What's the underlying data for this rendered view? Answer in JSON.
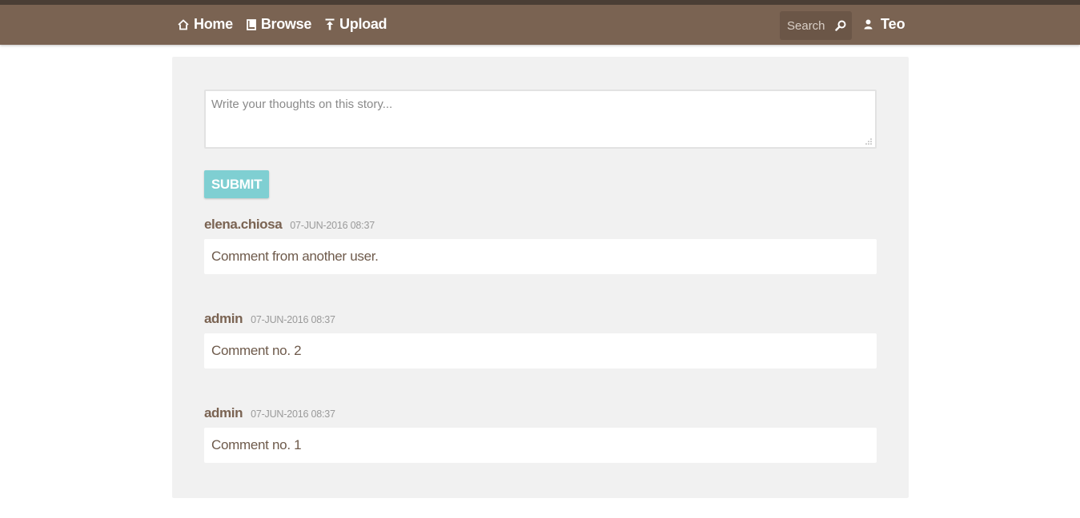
{
  "nav": {
    "items": [
      {
        "label": "Home",
        "icon": "home-icon"
      },
      {
        "label": "Browse",
        "icon": "book-icon"
      },
      {
        "label": "Upload",
        "icon": "upload-icon"
      }
    ],
    "search": {
      "placeholder": "Search",
      "icon": "search-icon"
    },
    "user": {
      "name": "Teo",
      "icon": "user-icon"
    }
  },
  "comment_form": {
    "placeholder": "Write your thoughts on this story...",
    "submit_label": "SUBMIT"
  },
  "comments": [
    {
      "author": "elena.chiosa",
      "date": "07-JUN-2016 08:37",
      "text": "Comment from another user."
    },
    {
      "author": "admin",
      "date": "07-JUN-2016 08:37",
      "text": "Comment no. 2"
    },
    {
      "author": "admin",
      "date": "07-JUN-2016 08:37",
      "text": "Comment no. 1"
    }
  ],
  "colors": {
    "navbar": "#7a6352",
    "accent_button": "#7fcfd2",
    "author_text": "#7a6352"
  }
}
